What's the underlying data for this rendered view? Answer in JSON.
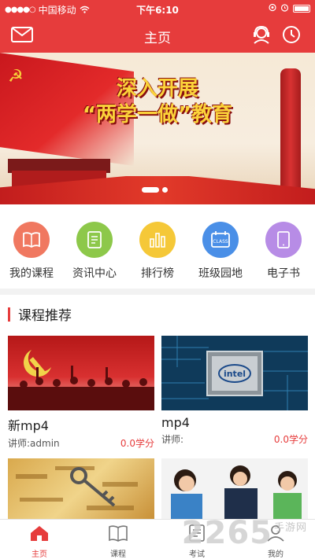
{
  "status": {
    "carrier": "中国移动",
    "time": "下午6:10"
  },
  "header": {
    "title": "主页"
  },
  "banner": {
    "line1": "深入开展",
    "line2": "“两学一做”教育"
  },
  "quicknav": [
    {
      "label": "我的课程",
      "icon": "book-icon",
      "color": "#f07860"
    },
    {
      "label": "资讯中心",
      "icon": "document-icon",
      "color": "#8dc84a"
    },
    {
      "label": "排行榜",
      "icon": "bar-chart-icon",
      "color": "#f5c838"
    },
    {
      "label": "班级园地",
      "icon": "calendar-icon",
      "color": "#4a8fe7"
    },
    {
      "label": "电子书",
      "icon": "tablet-icon",
      "color": "#b78ce6"
    }
  ],
  "courses": {
    "title": "课程推荐",
    "items": [
      {
        "name": "新mp4",
        "teacher": "讲师:admin",
        "credit": "0.0学分"
      },
      {
        "name": "mp4",
        "teacher": "讲师:",
        "credit": "0.0学分"
      }
    ]
  },
  "tabs": [
    {
      "label": "主页",
      "icon": "home-icon",
      "active": true
    },
    {
      "label": "课程",
      "icon": "open-book-icon"
    },
    {
      "label": "考试",
      "icon": "exam-icon"
    },
    {
      "label": "我的",
      "icon": "person-icon"
    }
  ],
  "watermark": {
    "brand": "2265",
    "suffix": "手游网"
  },
  "colors": {
    "accent": "#e63c3c"
  }
}
